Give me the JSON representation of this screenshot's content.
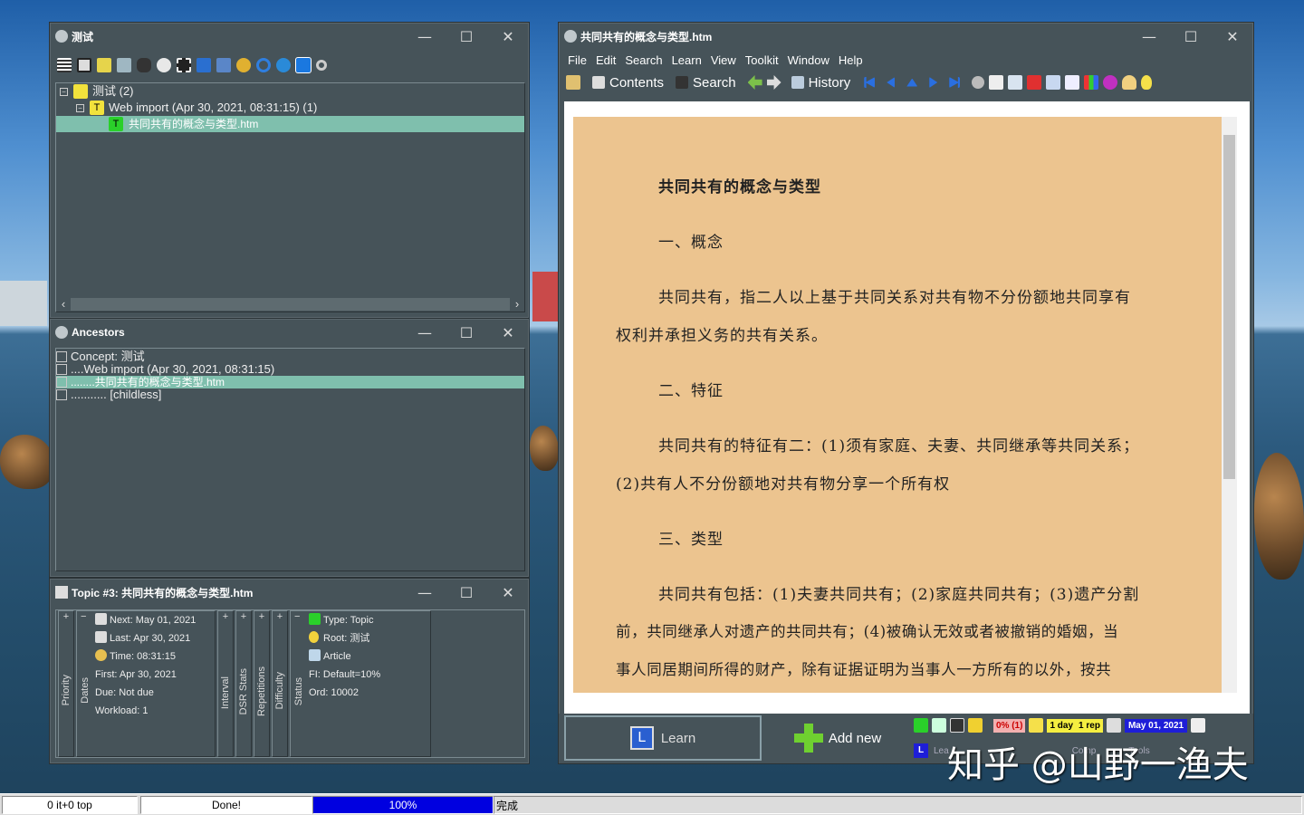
{
  "desktop": {
    "watermark": "知乎 @山野一渔夫"
  },
  "win1": {
    "title": "测试",
    "min": "—",
    "max": "☐",
    "close": "✕",
    "tree": [
      {
        "label": "测试 (2)"
      },
      {
        "label": "Web import (Apr 30, 2021, 08:31:15) (1)"
      },
      {
        "label": "共同共有的概念与类型.htm"
      }
    ],
    "scroll_left": "‹",
    "scroll_right": "›"
  },
  "win2": {
    "title": "Ancestors",
    "min": "—",
    "max": "☐",
    "close": "✕",
    "items": [
      "Concept: 测试",
      "....Web import (Apr 30, 2021, 08:31:15)",
      "........共同共有的概念与类型.htm",
      "........... [childless]"
    ]
  },
  "win3": {
    "title": "Topic #3: 共同共有的概念与类型.htm",
    "min": "—",
    "max": "☐",
    "close": "✕",
    "labels": {
      "priority": "Priority",
      "dates": "Dates",
      "interval": "Interval",
      "dsr": "DSR Stats",
      "repetitions": "Repetitions",
      "difficulty": "Difficulty",
      "status": "Status"
    },
    "dates": [
      "Next: May 01, 2021",
      "Last: Apr 30, 2021",
      "Time: 08:31:15",
      "First: Apr 30, 2021",
      "Due: Not due",
      "Workload: 1"
    ],
    "status": [
      "Type: Topic",
      "Root: 测试",
      "Article",
      "FI: Default=10%",
      "Ord: 10002"
    ],
    "plus": "+",
    "minus": "−"
  },
  "win4": {
    "title": "共同共有的概念与类型.htm",
    "min": "—",
    "max": "☐",
    "close": "✕",
    "menu": [
      "File",
      "Edit",
      "Search",
      "Learn",
      "View",
      "Toolkit",
      "Window",
      "Help"
    ],
    "btn_contents": "Contents",
    "btn_search": "Search",
    "btn_history": "History",
    "doc": {
      "title": "共同共有的概念与类型",
      "h1": "一、概念",
      "p1a": "共同共有，指二人以上基于共同关系对共有物不分份额地共同享有",
      "p1b": "权利并承担义务的共有关系。",
      "h2": "二、特征",
      "p2a": "共同共有的特征有二：(1)须有家庭、夫妻、共同继承等共同关系；",
      "p2b": "(2)共有人不分份额地对共有物分享一个所有权",
      "h3": "三、类型",
      "p3a": "共同共有包括：(1)夫妻共同共有；(2)家庭共同共有；(3)遗产分割",
      "p3b": "前，共同继承人对遗产的共同共有；(4)被确认无效或者被撤销的婚姻，当",
      "p3c": "事人同居期间所得的财产，除有证据证明为当事人一方所有的以外，按共"
    },
    "learn": "Learn",
    "addnew": "Add new",
    "mini": {
      "pct": "0% (1)",
      "day": "1 day",
      "rep": "1 rep",
      "date": "May 01, 2021",
      "learn2": "Lea",
      "comp": "Comp",
      "tools": "Tools"
    }
  },
  "statusbar": {
    "s1": "0 it+0 top",
    "s2": "Done!",
    "s3": "100%",
    "s4": "完成"
  },
  "colors": {
    "panel": "#465359",
    "selection": "#7fbfad",
    "doc_bg": "#ecc48f",
    "progress": "#0000e0"
  }
}
